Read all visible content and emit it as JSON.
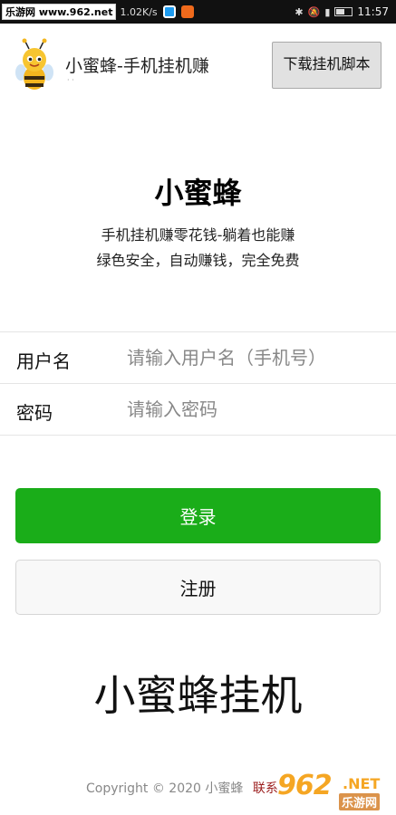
{
  "status_bar": {
    "watermark_tag": "乐游网 www.962.net",
    "net_speed": "1.02K/s",
    "time": "11:57"
  },
  "header": {
    "app_title": "小蜜蜂-手机挂机赚",
    "download_button": "下载挂机脚本"
  },
  "hero": {
    "title": "小蜜蜂",
    "subtitle_1": "手机挂机赚零花钱-躺着也能赚",
    "subtitle_2": "绿色安全，自动赚钱，完全免费"
  },
  "form": {
    "username_label": "用户名",
    "username_placeholder": "请输入用户名（手机号）",
    "password_label": "密码",
    "password_placeholder": "请输入密码"
  },
  "buttons": {
    "login": "登录",
    "register": "注册"
  },
  "big_title": "小蜜蜂挂机",
  "footer": {
    "copyright": "Copyright © 2020 小蜜蜂",
    "contact": "联系"
  },
  "watermark": {
    "number": "962",
    "net": ".NET",
    "site": "乐游网"
  },
  "colors": {
    "login_green": "#1aad19",
    "status_bar": "#111111",
    "watermark_orange": "#f5a623"
  },
  "icons": [
    "bee-logo-icon",
    "bluetooth-icon",
    "mute-icon",
    "signal-icon",
    "battery-icon"
  ]
}
